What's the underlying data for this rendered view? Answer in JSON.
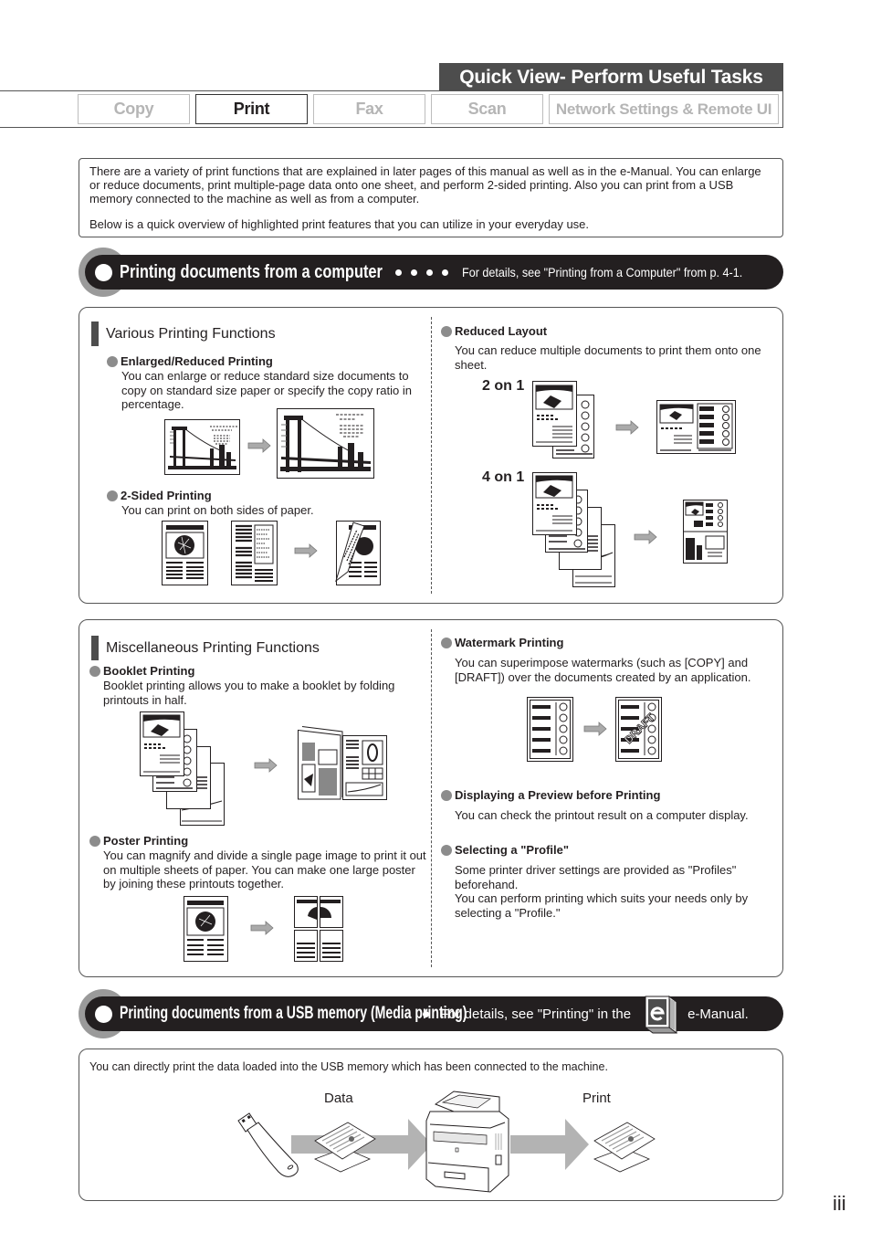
{
  "header": {
    "title": "Quick View- Perform Useful Tasks",
    "tabs": [
      {
        "label": "Copy",
        "active": false
      },
      {
        "label": "Print",
        "active": true
      },
      {
        "label": "Fax",
        "active": false
      },
      {
        "label": "Scan",
        "active": false
      },
      {
        "label": "Network Settings & Remote UI",
        "active": false
      }
    ]
  },
  "intro": {
    "paragraph1": "There are a variety of print functions that are explained in later pages of this manual as well as in the e-Manual.  You can enlarge or reduce documents, print multiple-page data onto one sheet, and perform 2-sided printing. Also you can print from a USB memory connected to the machine as well as from a computer.",
    "paragraph2": "Below is a quick overview of highlighted print features that you can utilize in your everyday use."
  },
  "section_computer": {
    "title": "Printing documents from a computer",
    "reference": "For details, see \"Printing from a Computer\" from p. 4-1."
  },
  "panel_various": {
    "heading": "Various Printing Functions",
    "items": [
      {
        "title": "Enlarged/Reduced Printing",
        "text": "You can enlarge or reduce standard size documents to copy on standard size paper or specify the copy ratio in percentage."
      },
      {
        "title": "2-Sided Printing",
        "text": "You can print on both sides of paper."
      },
      {
        "title": "Reduced Layout",
        "text": "You can reduce multiple documents to print them onto one sheet."
      }
    ],
    "layout_labels": [
      "2 on 1",
      "4 on 1"
    ]
  },
  "panel_misc": {
    "heading": "Miscellaneous Printing Functions",
    "items": [
      {
        "title": "Booklet Printing",
        "text": "Booklet printing allows you to make a booklet by folding printouts in half."
      },
      {
        "title": "Poster Printing",
        "text": "You can magnify and divide a single page image to print it out on multiple sheets of paper. You can make one large poster by joining these printouts together."
      },
      {
        "title": "Watermark Printing",
        "text": "You can superimpose watermarks (such as [COPY] and [DRAFT]) over the documents created by an application."
      },
      {
        "title": "Displaying a Preview before Printing",
        "text": "You can check the printout result on a computer display."
      },
      {
        "title": "Selecting a \"Profile\"",
        "text1": "Some printer driver settings are provided as \"Profiles\" beforehand.",
        "text2": "You can perform printing which suits your needs only by selecting a \"Profile.\""
      }
    ],
    "watermark_word": "DRAFT"
  },
  "section_usb": {
    "title": "Printing documents from a USB memory (Media printing)",
    "reference_prefix": "For details, see \"Printing\" in the",
    "reference_suffix": "e-Manual.",
    "emanual_icon": "e-manual-book-icon"
  },
  "panel_usb": {
    "text": "You can directly print the data loaded into the USB memory which has been connected to the machine.",
    "data_label": "Data",
    "print_label": "Print"
  },
  "footer": {
    "page_number": "iii"
  }
}
